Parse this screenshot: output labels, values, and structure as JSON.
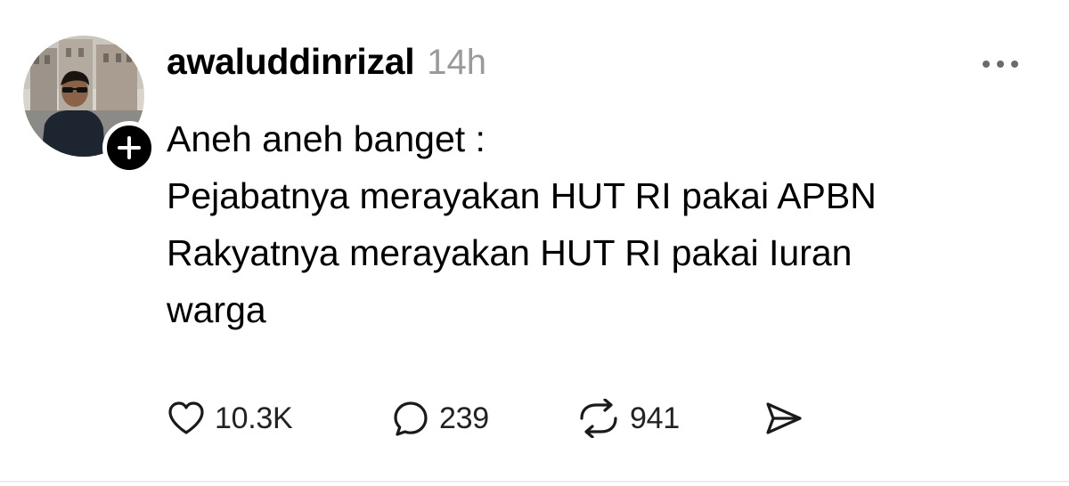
{
  "post": {
    "username": "awaluddinrizal",
    "timestamp": "14h",
    "text_lines": [
      "Aneh aneh banget :",
      "Pejabatnya merayakan HUT RI pakai APBN",
      "Rakyatnya merayakan HUT RI pakai Iuran",
      "warga"
    ],
    "actions": {
      "likes": "10.3K",
      "replies": "239",
      "reposts": "941"
    }
  },
  "icons": {
    "follow": "plus-icon",
    "more": "more-horizontal-icon",
    "like": "heart-icon",
    "reply": "comment-icon",
    "repost": "repost-icon",
    "share": "send-icon"
  },
  "colors": {
    "text": "#000000",
    "muted": "#9a9a9a",
    "icon": "#1a1a1a"
  }
}
